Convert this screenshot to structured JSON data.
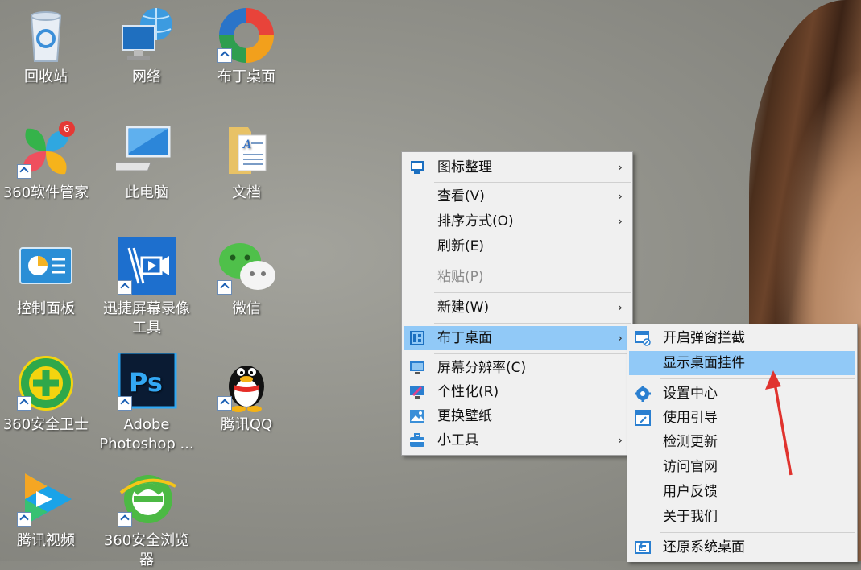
{
  "desktop": {
    "icons": [
      {
        "label": "回收站",
        "icon": "recycle-bin-icon"
      },
      {
        "label": "网络",
        "icon": "network-icon"
      },
      {
        "label": "布丁桌面",
        "icon": "buding-desktop-icon"
      },
      {
        "label": "360软件管家",
        "icon": "360-software-manager-icon",
        "badge": "6"
      },
      {
        "label": "此电脑",
        "icon": "this-pc-icon"
      },
      {
        "label": "文档",
        "icon": "documents-folder-icon"
      },
      {
        "label": "控制面板",
        "icon": "control-panel-icon"
      },
      {
        "label": "迅捷屏幕录像工具",
        "icon": "screen-recorder-icon"
      },
      {
        "label": "微信",
        "icon": "wechat-icon"
      },
      {
        "label": "360安全卫士",
        "icon": "360-security-icon"
      },
      {
        "label": "Adobe Photoshop ...",
        "icon": "photoshop-icon",
        "ps_text": "Ps"
      },
      {
        "label": "腾讯QQ",
        "icon": "qq-icon"
      },
      {
        "label": "腾讯视频",
        "icon": "tencent-video-icon"
      },
      {
        "label": "360安全浏览器",
        "icon": "360-browser-icon"
      }
    ]
  },
  "context_menu": {
    "items": [
      {
        "label": "图标整理",
        "has_submenu": true,
        "icon": "icon-arrange-icon"
      },
      {
        "label": "查看(V)",
        "has_submenu": true
      },
      {
        "label": "排序方式(O)",
        "has_submenu": true
      },
      {
        "label": "刷新(E)"
      },
      {
        "label": "粘贴(P)",
        "disabled": true
      },
      {
        "label": "新建(W)",
        "has_submenu": true
      },
      {
        "label": "布丁桌面",
        "has_submenu": true,
        "highlighted": true,
        "icon": "buding-menu-icon"
      },
      {
        "label": "屏幕分辨率(C)",
        "icon": "display-icon"
      },
      {
        "label": "个性化(R)",
        "icon": "personalize-icon"
      },
      {
        "label": "更换壁纸",
        "icon": "wallpaper-icon"
      },
      {
        "label": "小工具",
        "has_submenu": true,
        "icon": "toolbox-icon"
      }
    ],
    "arrow_glyph": "›"
  },
  "submenu": {
    "items": [
      {
        "label": "开启弹窗拦截",
        "icon": "popup-block-icon"
      },
      {
        "label": "显示桌面挂件",
        "highlighted": true
      },
      {
        "label": "设置中心",
        "icon": "settings-gear-icon"
      },
      {
        "label": "使用引导",
        "icon": "guide-icon"
      },
      {
        "label": "检测更新"
      },
      {
        "label": "访问官网"
      },
      {
        "label": "用户反馈"
      },
      {
        "label": "关于我们"
      },
      {
        "label": "还原系统桌面",
        "icon": "restore-desktop-icon"
      }
    ]
  },
  "colors": {
    "menu_highlight": "#91c9f7",
    "annotation_arrow": "#e0332e"
  }
}
